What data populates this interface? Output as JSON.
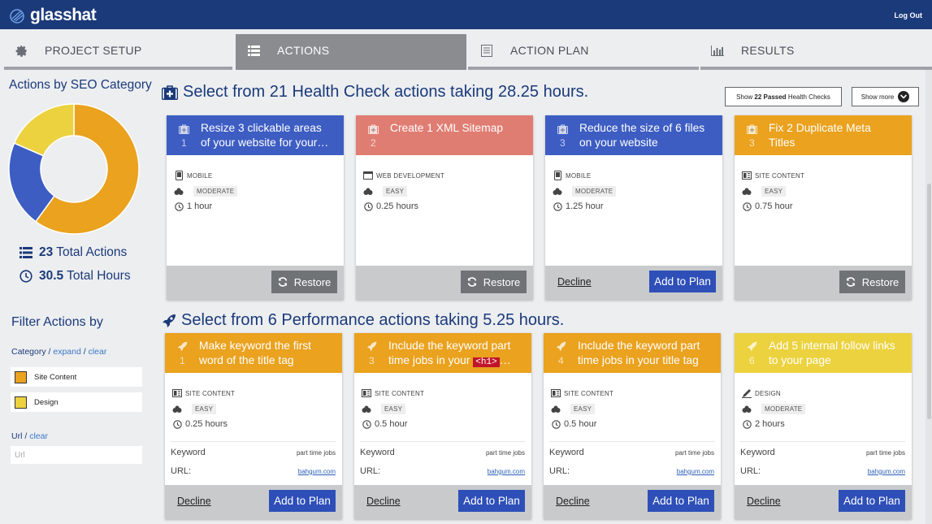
{
  "app": {
    "logo": "glasshat",
    "logout": "Log Out"
  },
  "tabs": [
    {
      "label": "PROJECT SETUP",
      "icon": "gear-icon",
      "active": false
    },
    {
      "label": "ACTIONS",
      "icon": "list-icon",
      "active": true
    },
    {
      "label": "ACTION PLAN",
      "icon": "document-icon",
      "active": false
    },
    {
      "label": "RESULTS",
      "icon": "bar-chart-icon",
      "active": false
    }
  ],
  "sidebar": {
    "title": "Actions by SEO Category",
    "donut": [
      {
        "category": "Site Content",
        "fraction": 0.6,
        "color": "#eaa21f"
      },
      {
        "category": "Mobile",
        "fraction": 0.215,
        "color": "#3d5dc3"
      },
      {
        "category": "Design",
        "fraction": 0.185,
        "color": "#ecd23f"
      }
    ],
    "total_actions_value": "23",
    "total_actions_label": "Total Actions",
    "total_hours_value": "30.5",
    "total_hours_label": "Total Hours",
    "filter_title": "Filter Actions by",
    "category_label": "Category",
    "sep": "/",
    "expand": "expand",
    "clear": "clear",
    "filters": [
      {
        "label": "Site Content",
        "color": "#eaa21f"
      },
      {
        "label": "Design",
        "color": "#ecd23f"
      }
    ],
    "url_label": "Url",
    "url_clear": "clear",
    "url_placeholder": "Url"
  },
  "header_buttons": {
    "passed_prefix": "Show",
    "passed_count": "22",
    "passed_bold": "Passed",
    "passed_suffix": "Health Checks",
    "show_more": "Show more"
  },
  "sections": [
    {
      "title": "Select from 21 Health Check actions taking 28.25 hours.",
      "icon": "medkit-icon"
    },
    {
      "title": "Select from 6 Performance actions taking 5.25 hours.",
      "icon": "rocket-icon"
    }
  ],
  "health_cards": [
    {
      "num": "1",
      "title": "Resize 3 clickable areas of your website for your…",
      "color": "#3d5dc3",
      "category": "MOBILE",
      "category_icon": "mobile-icon",
      "difficulty": "MODERATE",
      "hours": "1 hour",
      "state": "declined",
      "restore": "Restore"
    },
    {
      "num": "2",
      "title": "Create 1 XML Sitemap",
      "color": "#e07d72",
      "category": "WEB DEVELOPMENT",
      "category_icon": "browser-icon",
      "difficulty": "EASY",
      "hours": "0.25 hours",
      "state": "declined",
      "restore": "Restore"
    },
    {
      "num": "3",
      "title": "Reduce the size of 6 files on your website",
      "color": "#3d5dc3",
      "category": "MOBILE",
      "category_icon": "mobile-icon",
      "difficulty": "MODERATE",
      "hours": "1.25 hour",
      "state": "open",
      "decline": "Decline",
      "add": "Add to Plan"
    },
    {
      "num": "3",
      "title": "Fix 2 Duplicate Meta Titles",
      "color": "#eaa21f",
      "category": "SITE CONTENT",
      "category_icon": "content-icon",
      "difficulty": "EASY",
      "hours": "0.75 hour",
      "state": "declined",
      "restore": "Restore"
    }
  ],
  "perf_cards": [
    {
      "num": "1",
      "title": "Make keyword the first word of the title tag",
      "code": "",
      "title_suffix": "",
      "color": "#eaa21f",
      "category": "SITE CONTENT",
      "category_icon": "content-icon",
      "difficulty": "EASY",
      "hours": "0.25 hours",
      "keyword_label": "Keyword",
      "keyword": "part time jobs",
      "url_label": "URL:",
      "url": "bahgum.com",
      "decline": "Decline",
      "add": "Add to Plan"
    },
    {
      "num": "3",
      "title": "Include the keyword part time jobs in your",
      "code": "<h1>",
      "title_suffix": "…",
      "color": "#eaa21f",
      "category": "SITE CONTENT",
      "category_icon": "content-icon",
      "difficulty": "EASY",
      "hours": "0.5 hour",
      "keyword_label": "Keyword",
      "keyword": "part time jobs",
      "url_label": "URL:",
      "url": "bahgum.com",
      "decline": "Decline",
      "add": "Add to Plan"
    },
    {
      "num": "4",
      "title": "Include the keyword part time jobs in your title tag",
      "code": "",
      "title_suffix": "",
      "color": "#eaa21f",
      "category": "SITE CONTENT",
      "category_icon": "content-icon",
      "difficulty": "EASY",
      "hours": "0.5 hour",
      "keyword_label": "Keyword",
      "keyword": "part time jobs",
      "url_label": "URL:",
      "url": "bahgum.com",
      "decline": "Decline",
      "add": "Add to Plan"
    },
    {
      "num": "6",
      "title": "Add 5 internal follow links to your page",
      "code": "",
      "title_suffix": "",
      "color": "#ecd23f",
      "category": "DESIGN",
      "category_icon": "pen-icon",
      "difficulty": "MODERATE",
      "hours": "2 hours",
      "keyword_label": "Keyword",
      "keyword": "part time jobs",
      "url_label": "URL:",
      "url": "bahgum.com",
      "decline": "Decline",
      "add": "Add to Plan"
    }
  ]
}
